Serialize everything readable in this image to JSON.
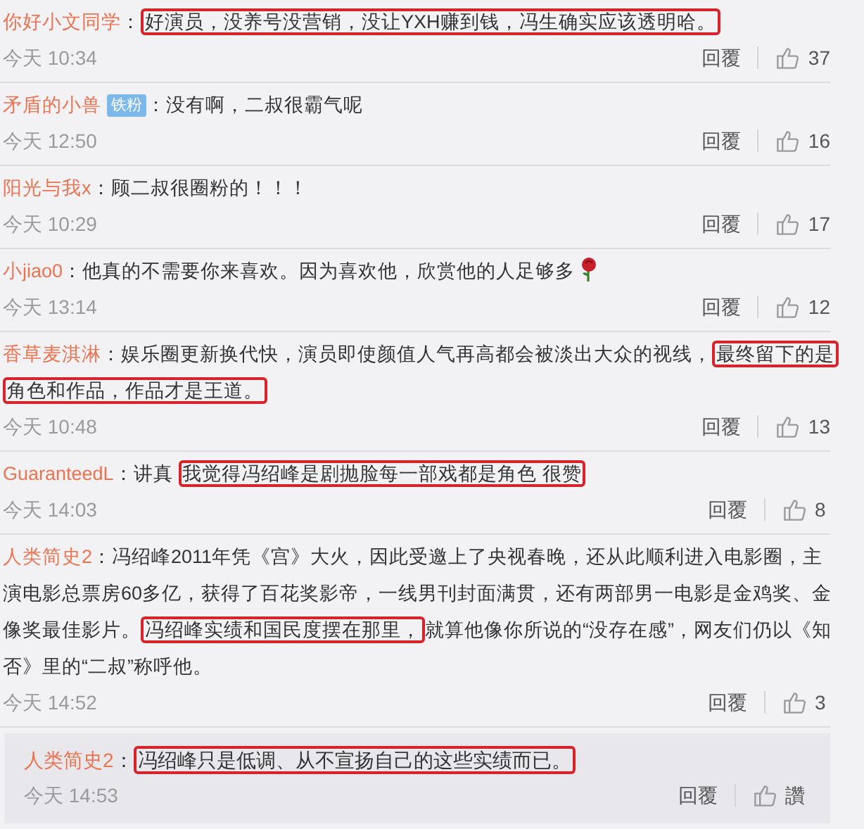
{
  "comments": [
    {
      "kind": "comment",
      "user": "你好小文同学",
      "segments": [
        {
          "text": "：",
          "highlighted": false
        },
        {
          "text": "好演员，没养号没营销，没让YXH赚到钱，冯生确实应该透明哈。",
          "highlighted": true
        }
      ],
      "time": "今天 10:34",
      "reply": "回覆",
      "likes": "37"
    },
    {
      "kind": "comment",
      "user": "矛盾的小兽",
      "badge": "铁粉",
      "segments": [
        {
          "text": "：没有啊，二叔很霸气呢",
          "highlighted": false
        }
      ],
      "time": "今天 12:50",
      "reply": "回覆",
      "likes": "16"
    },
    {
      "kind": "comment",
      "user": "阳光与我x",
      "segments": [
        {
          "text": "：顾二叔很圈粉的！！！",
          "highlighted": false
        }
      ],
      "time": "今天 10:29",
      "reply": "回覆",
      "likes": "17"
    },
    {
      "kind": "comment",
      "user": "小jiao0",
      "segments": [
        {
          "text": "：他真的不需要你来喜欢。因为喜欢他，欣赏他的人足够多",
          "highlighted": false
        }
      ],
      "emoji": true,
      "time": "今天 13:14",
      "reply": "回覆",
      "likes": "12"
    },
    {
      "kind": "comment",
      "user": "香草麦淇淋",
      "segments": [
        {
          "text": "：娱乐圈更新换代快，演员即使颜值人气再高都会被淡出大众的视线，",
          "highlighted": false
        },
        {
          "text": "最终留下的是角色和作品，作品才是王道。",
          "highlighted": true
        }
      ],
      "time": "今天 10:48",
      "reply": "回覆",
      "likes": "13"
    },
    {
      "kind": "comment",
      "user": "GuaranteedL",
      "segments": [
        {
          "text": "：讲真 ",
          "highlighted": false
        },
        {
          "text": "我觉得冯绍峰是剧抛脸每一部戏都是角色 很赞",
          "highlighted": true
        }
      ],
      "time": "今天 14:03",
      "reply": "回覆",
      "likes": "8"
    },
    {
      "kind": "comment",
      "user": "人类简史2",
      "segments": [
        {
          "text": "：冯绍峰2011年凭《宫》大火，因此受邀上了央视春晚，还从此顺利进入电影圈，主演电影总票房60多亿，获得了百花奖影帝，一线男刊封面满贯，还有两部男一电影是金鸡奖、金像奖最佳影片。",
          "highlighted": false
        },
        {
          "text": "冯绍峰实绩和国民度摆在那里，",
          "highlighted": true
        },
        {
          "text": "就算他像你所说的“没存在感”，网友们仍以《知否》里的“二叔”称呼他。",
          "highlighted": false
        }
      ],
      "time": "今天 14:52",
      "reply": "回覆",
      "likes": "3"
    },
    {
      "kind": "reply",
      "user": "人类简史2",
      "segments": [
        {
          "text": "：",
          "highlighted": false
        },
        {
          "text": "冯绍峰只是低调、从不宣扬自己的这些实绩而已。",
          "highlighted": true
        }
      ],
      "time": "今天 14:53",
      "reply": "回覆",
      "likes": "讚"
    }
  ]
}
